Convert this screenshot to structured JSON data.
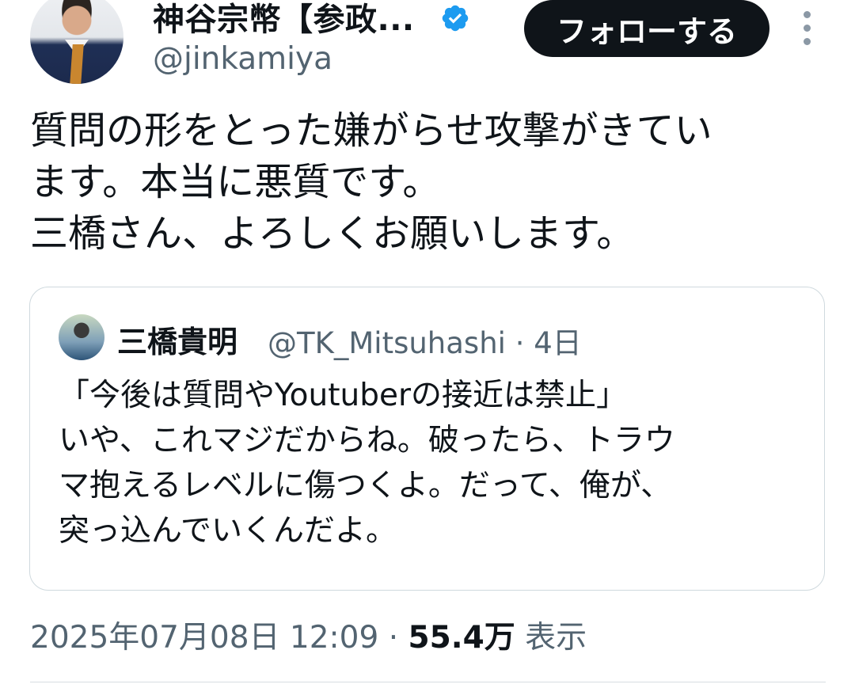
{
  "author": {
    "name": "神谷宗幣【参政...",
    "handle": "@jinkamiya",
    "verified": true
  },
  "follow_button": {
    "label": "フォローする"
  },
  "icons": {
    "more": "more-vertical-icon",
    "verified": "verified-badge-icon"
  },
  "post": {
    "text": "質問の形をとった嫌がらせ攻撃がきてい\nます。本当に悪質です。\n三橋さん、よろしくお願いします。"
  },
  "quote": {
    "name": "三橋貴明",
    "handle_time": "@TK_Mitsuhashi · 4日",
    "text": "「今後は質問やYoutuberの接近は禁止」\nいや、これマジだからね。破ったら、トラウ\nマ抱えるレベルに傷つくよ。だって、俺が、\n突っ込んでいくんだよ。"
  },
  "meta": {
    "timestamp": "2025年07月08日 12:09",
    "separator": " · ",
    "views_count": "55.4万",
    "views_label": " 表示"
  },
  "colors": {
    "verified": "#1d9bf0",
    "follow_bg": "#0f1419",
    "secondary_text": "#536471"
  }
}
